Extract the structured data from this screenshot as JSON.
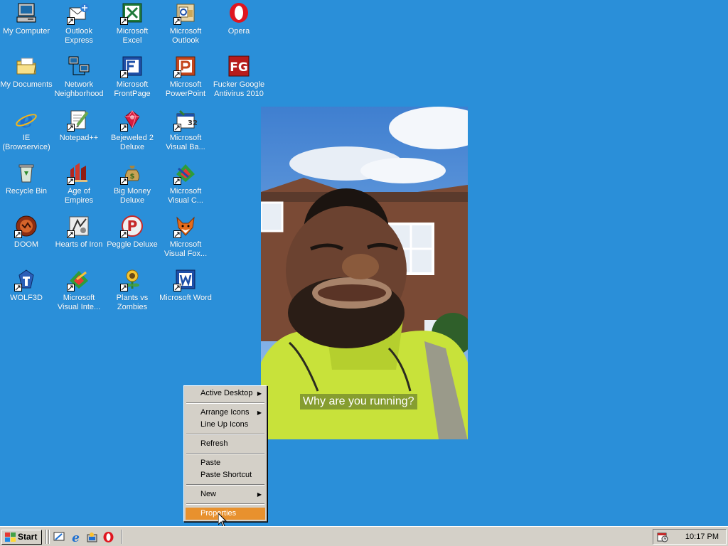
{
  "desktop": {
    "icons": [
      {
        "label": "My Computer"
      },
      {
        "label": "Outlook Express"
      },
      {
        "label": "Microsoft Excel"
      },
      {
        "label": "Microsoft Outlook"
      },
      {
        "label": "Opera"
      },
      {
        "label": "My Documents"
      },
      {
        "label": "Network Neighborhood"
      },
      {
        "label": "Microsoft FrontPage"
      },
      {
        "label": "Microsoft PowerPoint"
      },
      {
        "label": "Fucker Google Antivirus 2010"
      },
      {
        "label": "IE (Browservice)"
      },
      {
        "label": "Notepad++"
      },
      {
        "label": "Bejeweled 2 Deluxe"
      },
      {
        "label": "Microsoft Visual Ba..."
      },
      {
        "label": "Recycle Bin"
      },
      {
        "label": "Age of Empires"
      },
      {
        "label": "Big Money Deluxe"
      },
      {
        "label": "Microsoft Visual C..."
      },
      {
        "label": "DOOM"
      },
      {
        "label": "Hearts of Iron"
      },
      {
        "label": "Peggle Deluxe"
      },
      {
        "label": "Microsoft Visual Fox..."
      },
      {
        "label": "WOLF3D"
      },
      {
        "label": "Microsoft Visual Inte..."
      },
      {
        "label": "Plants vs Zombies"
      },
      {
        "label": "Microsoft Word"
      }
    ]
  },
  "photo": {
    "caption": "Why are you running?"
  },
  "context_menu": {
    "items": {
      "active_desktop": "Active Desktop",
      "arrange_icons": "Arrange Icons",
      "line_up_icons": "Line Up Icons",
      "refresh": "Refresh",
      "paste": "Paste",
      "paste_shortcut": "Paste Shortcut",
      "new": "New",
      "properties": "Properties"
    },
    "highlight_color": "#e8912e"
  },
  "taskbar": {
    "start_label": "Start",
    "clock": "10:17 PM"
  },
  "colors": {
    "desktop_background": "#2a8fd9",
    "taskbar": "#d4d0c8"
  }
}
